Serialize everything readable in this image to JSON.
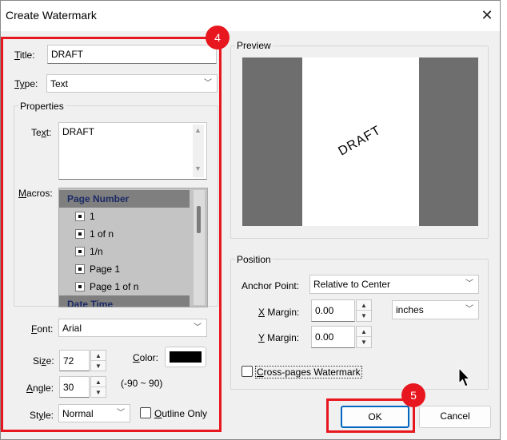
{
  "window": {
    "title": "Create Watermark",
    "close_glyph": "✕"
  },
  "left": {
    "title_label_u": "T",
    "title_label_rest": "itle:",
    "title_value": "DRAFT",
    "type_label_u": "Ty",
    "type_label_rest": "pe:",
    "type_value": "Text",
    "properties_label": "Properties",
    "text_label_pre": "Te",
    "text_label_u": "x",
    "text_label_post": "t:",
    "text_value": "DRAFT",
    "macros_label_u": "M",
    "macros_label_rest": "acros:",
    "macros": {
      "headers": [
        "Page Number",
        "Date Time"
      ],
      "items": [
        "1",
        "1 of n",
        "1/n",
        "Page 1",
        "Page 1 of n"
      ]
    },
    "font_label_u": "F",
    "font_label_rest": "ont:",
    "font_value": "Arial",
    "size_label_pre": "Si",
    "size_label_u": "z",
    "size_label_post": "e:",
    "size_value": "72",
    "color_label_pre": "",
    "color_label_u": "C",
    "color_label_post": "olor:",
    "color_swatch": "#000000",
    "angle_label_u": "A",
    "angle_label_rest": "ngle:",
    "angle_value": "30",
    "angle_range": "(-90 ~ 90)",
    "style_label_pre": "St",
    "style_label_u": "y",
    "style_label_post": "le:",
    "style_value": "Normal",
    "outline_label_u": "O",
    "outline_label_rest": "utline Only",
    "outline_checked": false
  },
  "right": {
    "preview_label": "Preview",
    "preview_text": "DRAFT",
    "position_label": "Position",
    "anchor_label": "Anchor Point:",
    "anchor_value": "Relative to Center",
    "xmargin_label_u": "X",
    "xmargin_label_rest": " Margin:",
    "xmargin_value": "0.00",
    "units_value": "inches",
    "ymargin_label_u": "Y",
    "ymargin_label_rest": " Margin:",
    "ymargin_value": "0.00",
    "crosspages_label_u": "C",
    "crosspages_label_rest": "ross-pages Watermark",
    "crosspages_checked": false
  },
  "buttons": {
    "ok": "OK",
    "cancel": "Cancel"
  },
  "annotations": {
    "badge_4": "4",
    "badge_5": "5",
    "highlight_color": "#e8171f"
  },
  "icons": {
    "spin_up": "▲",
    "spin_down": "▼",
    "dropdown": "﹀",
    "scroll_up": "▲",
    "scroll_down": "▼"
  }
}
